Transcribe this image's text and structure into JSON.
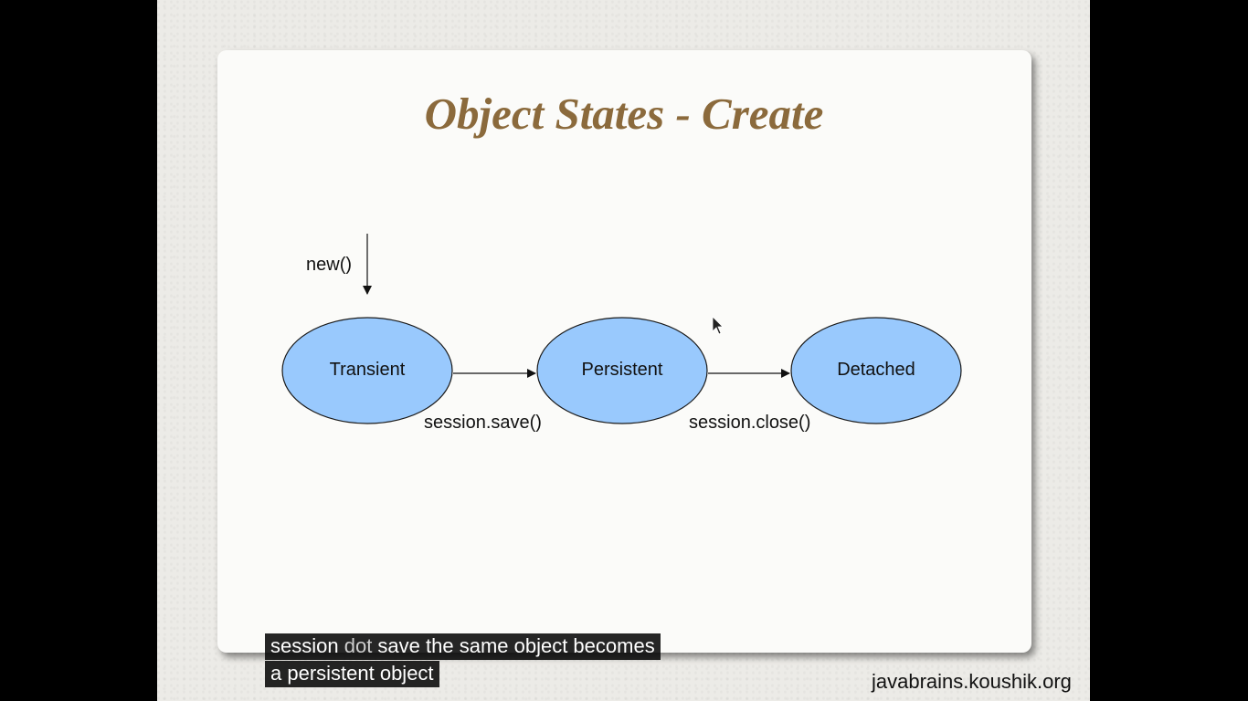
{
  "slide": {
    "title": "Object States - Create"
  },
  "diagram": {
    "entry_label": "new()",
    "nodes": [
      {
        "label": "Transient"
      },
      {
        "label": "Persistent"
      },
      {
        "label": "Detached"
      }
    ],
    "edges": [
      {
        "label": "session.save()"
      },
      {
        "label": "session.close()"
      }
    ],
    "node_fill": "#99c9fd",
    "node_stroke": "#1a1a1a"
  },
  "captions": {
    "line1_a": "session ",
    "line1_b": "dot",
    "line1_c": " save the same object becomes",
    "line2": "a persistent object"
  },
  "watermark": "javabrains.koushik.org"
}
